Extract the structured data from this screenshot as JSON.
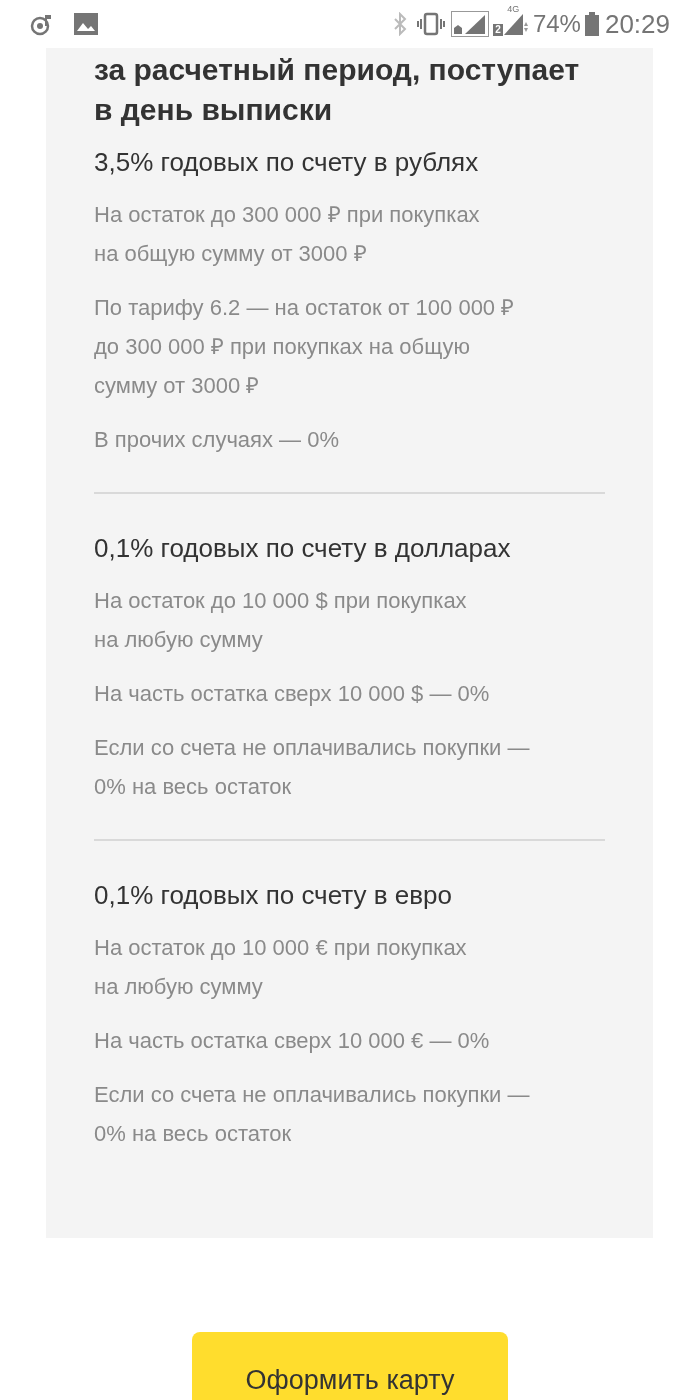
{
  "status_bar": {
    "network": "4G",
    "sim": "2",
    "battery": "74%",
    "time": "20:29"
  },
  "heading": "за расчетный период, поступает\nв день выписки",
  "sections": [
    {
      "title": "3,5% годовых по счету в рублях",
      "paragraphs": [
        "На остаток до 300 000 ₽ при покупках\nна общую сумму от 3000 ₽",
        "По тарифу 6.2 — на остаток от 100 000 ₽\nдо 300 000 ₽ при покупках на общую\nсумму от 3000 ₽",
        "В прочих случаях — 0%"
      ]
    },
    {
      "title": "0,1% годовых по счету в долларах",
      "paragraphs": [
        "На остаток до 10 000 $ при покупках\nна любую сумму",
        "На часть остатка сверх 10 000 $ — 0%",
        "Если со счета не оплачивались покупки —\n0% на весь остаток"
      ]
    },
    {
      "title": "0,1% годовых по счету в евро",
      "paragraphs": [
        "На остаток до 10 000 € при покупках\nна любую сумму",
        "На часть остатка сверх 10 000 € — 0%",
        "Если со счета не оплачивались покупки —\n0% на весь остаток"
      ]
    }
  ],
  "button": "Оформить карту"
}
